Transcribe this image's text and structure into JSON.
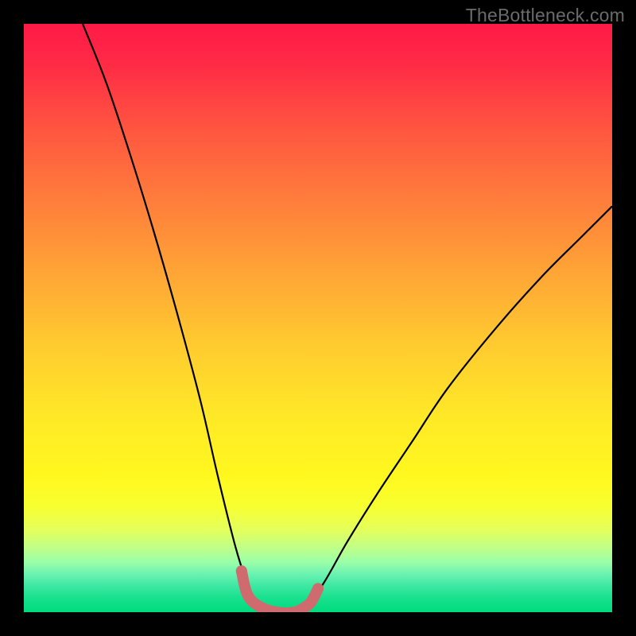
{
  "watermark": "TheBottleneck.com",
  "chart_data": {
    "type": "line",
    "title": "",
    "xlabel": "",
    "ylabel": "",
    "xlim": [
      0,
      100
    ],
    "ylim": [
      0,
      100
    ],
    "curve": {
      "name": "bottleneck-curve",
      "color": "#000000",
      "points": [
        {
          "x": 10,
          "y": 100
        },
        {
          "x": 14,
          "y": 90
        },
        {
          "x": 18,
          "y": 78
        },
        {
          "x": 22,
          "y": 65
        },
        {
          "x": 26,
          "y": 51
        },
        {
          "x": 30,
          "y": 36
        },
        {
          "x": 33,
          "y": 23
        },
        {
          "x": 36,
          "y": 11
        },
        {
          "x": 38,
          "y": 5
        },
        {
          "x": 40,
          "y": 1
        },
        {
          "x": 43,
          "y": 0
        },
        {
          "x": 46,
          "y": 0
        },
        {
          "x": 48,
          "y": 1
        },
        {
          "x": 51,
          "y": 5
        },
        {
          "x": 55,
          "y": 12
        },
        {
          "x": 60,
          "y": 20
        },
        {
          "x": 66,
          "y": 29
        },
        {
          "x": 72,
          "y": 38
        },
        {
          "x": 80,
          "y": 48
        },
        {
          "x": 88,
          "y": 57
        },
        {
          "x": 95,
          "y": 64
        },
        {
          "x": 100,
          "y": 69
        }
      ]
    },
    "highlight": {
      "name": "optimal-zone",
      "color": "#cf6a6f",
      "thickness": 14,
      "points": [
        {
          "x": 37,
          "y": 7
        },
        {
          "x": 38,
          "y": 3
        },
        {
          "x": 40,
          "y": 1
        },
        {
          "x": 43,
          "y": 0
        },
        {
          "x": 46,
          "y": 0
        },
        {
          "x": 48,
          "y": 1
        },
        {
          "x": 49,
          "y": 2
        },
        {
          "x": 50,
          "y": 4
        }
      ]
    },
    "gradient_stops": [
      {
        "offset": 0.0,
        "color": "#ff1a47"
      },
      {
        "offset": 0.07,
        "color": "#ff2b45"
      },
      {
        "offset": 0.18,
        "color": "#ff5640"
      },
      {
        "offset": 0.3,
        "color": "#ff7d3b"
      },
      {
        "offset": 0.42,
        "color": "#ffa436"
      },
      {
        "offset": 0.55,
        "color": "#ffcc2f"
      },
      {
        "offset": 0.67,
        "color": "#ffe927"
      },
      {
        "offset": 0.77,
        "color": "#fff81e"
      },
      {
        "offset": 0.82,
        "color": "#f8ff30"
      },
      {
        "offset": 0.86,
        "color": "#e4ff5c"
      },
      {
        "offset": 0.89,
        "color": "#c0ff88"
      },
      {
        "offset": 0.915,
        "color": "#9affa8"
      },
      {
        "offset": 0.935,
        "color": "#6cf2b2"
      },
      {
        "offset": 0.955,
        "color": "#3ee8a2"
      },
      {
        "offset": 0.975,
        "color": "#19e18e"
      },
      {
        "offset": 1.0,
        "color": "#00db7e"
      }
    ]
  }
}
